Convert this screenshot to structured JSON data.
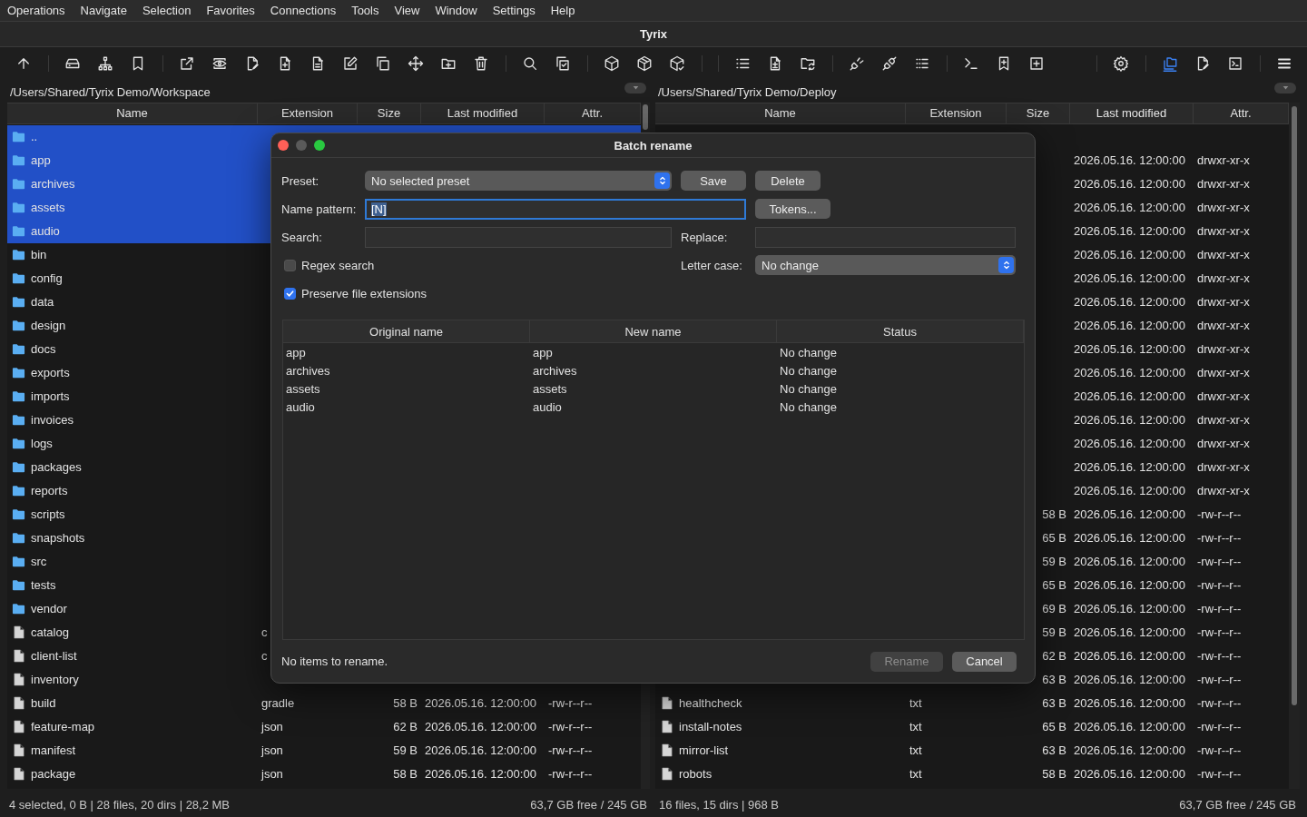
{
  "menu": [
    "Operations",
    "Navigate",
    "Selection",
    "Favorites",
    "Connections",
    "Tools",
    "View",
    "Window",
    "Settings",
    "Help"
  ],
  "window": {
    "title": "Tyrix"
  },
  "toolbar": [
    {
      "selected": false
    },
    {
      "selected": false
    },
    {
      "selected": false
    },
    {
      "selected": false
    },
    {
      "selected": false
    },
    {
      "selected": false
    },
    {
      "selected": false
    },
    {
      "selected": false
    },
    {
      "selected": false
    },
    {
      "selected": false
    },
    {
      "selected": false
    },
    {
      "selected": false
    },
    {
      "selected": false
    },
    {
      "selected": false
    },
    {
      "selected": false
    },
    {
      "selected": false
    },
    {
      "selected": false
    },
    {
      "selected": false
    },
    {
      "selected": false
    },
    {
      "selected": false
    },
    {
      "selected": false
    },
    {
      "selected": false
    },
    {
      "selected": false
    },
    {
      "selected": false
    },
    {
      "selected": false
    },
    {
      "selected": false
    },
    {
      "selected": false
    },
    {
      "selected": false
    },
    {
      "selected": false
    },
    {
      "selected": true
    },
    {
      "selected": false
    },
    {
      "selected": false
    },
    {
      "selected": false
    }
  ],
  "left_panel": {
    "path": "/Users/Shared/Tyrix Demo/Workspace",
    "columns": [
      "Name",
      "Extension",
      "Size",
      "Last modified",
      "Attr."
    ],
    "rows": [
      {
        "kind": "up",
        "name": "..",
        "selected": true
      },
      {
        "kind": "dir",
        "name": "app",
        "selected": true
      },
      {
        "kind": "dir",
        "name": "archives",
        "selected": true
      },
      {
        "kind": "dir",
        "name": "assets",
        "selected": true
      },
      {
        "kind": "dir",
        "name": "audio",
        "selected": true
      },
      {
        "kind": "dir",
        "name": "bin",
        "selected": false
      },
      {
        "kind": "dir",
        "name": "config",
        "selected": false
      },
      {
        "kind": "dir",
        "name": "data",
        "selected": false
      },
      {
        "kind": "dir",
        "name": "design",
        "selected": false
      },
      {
        "kind": "dir",
        "name": "docs",
        "selected": false
      },
      {
        "kind": "dir",
        "name": "exports",
        "selected": false
      },
      {
        "kind": "dir",
        "name": "imports",
        "selected": false
      },
      {
        "kind": "dir",
        "name": "invoices",
        "selected": false
      },
      {
        "kind": "dir",
        "name": "logs",
        "selected": false
      },
      {
        "kind": "dir",
        "name": "packages",
        "selected": false
      },
      {
        "kind": "dir",
        "name": "reports",
        "selected": false
      },
      {
        "kind": "dir",
        "name": "scripts",
        "selected": false
      },
      {
        "kind": "dir",
        "name": "snapshots",
        "selected": false
      },
      {
        "kind": "dir",
        "name": "src",
        "selected": false
      },
      {
        "kind": "dir",
        "name": "tests",
        "selected": false
      },
      {
        "kind": "dir",
        "name": "vendor",
        "selected": false
      },
      {
        "kind": "file",
        "name": "catalog",
        "ext": "c",
        "selected": false
      },
      {
        "kind": "file",
        "name": "client-list",
        "ext": "c",
        "selected": false
      },
      {
        "kind": "file",
        "name": "inventory",
        "selected": false
      },
      {
        "kind": "file",
        "name": "build",
        "ext": "gradle",
        "size": "58 B",
        "date": "2026.05.16. 12:00:00",
        "attr": "-rw-r--r--",
        "selected": false
      },
      {
        "kind": "file",
        "name": "feature-map",
        "ext": "json",
        "size": "62 B",
        "date": "2026.05.16. 12:00:00",
        "attr": "-rw-r--r--",
        "selected": false
      },
      {
        "kind": "file",
        "name": "manifest",
        "ext": "json",
        "size": "59 B",
        "date": "2026.05.16. 12:00:00",
        "attr": "-rw-r--r--",
        "selected": false
      },
      {
        "kind": "file",
        "name": "package",
        "ext": "json",
        "size": "58 B",
        "date": "2026.05.16. 12:00:00",
        "attr": "-rw-r--r--",
        "selected": false
      }
    ],
    "status": "4 selected, 0 B | 28 files, 20 dirs | 28,2 MB",
    "free": "63,7 GB free / 245 GB"
  },
  "right_panel": {
    "path": "/Users/Shared/Tyrix Demo/Deploy",
    "columns": [
      "Name",
      "Extension",
      "Size",
      "Last modified",
      "Attr."
    ],
    "rows": [
      {
        "date": "2026.05.16. 12:00:00",
        "attr": "drwxr-xr-x",
        "selected": false
      },
      {
        "date": "2026.05.16. 12:00:00",
        "attr": "drwxr-xr-x",
        "selected": false
      },
      {
        "date": "2026.05.16. 12:00:00",
        "attr": "drwxr-xr-x",
        "selected": false
      },
      {
        "date": "2026.05.16. 12:00:00",
        "attr": "drwxr-xr-x",
        "selected": false
      },
      {
        "date": "2026.05.16. 12:00:00",
        "attr": "drwxr-xr-x",
        "selected": false
      },
      {
        "date": "2026.05.16. 12:00:00",
        "attr": "drwxr-xr-x",
        "selected": false
      },
      {
        "date": "2026.05.16. 12:00:00",
        "attr": "drwxr-xr-x",
        "selected": false
      },
      {
        "date": "2026.05.16. 12:00:00",
        "attr": "drwxr-xr-x",
        "selected": false
      },
      {
        "date": "2026.05.16. 12:00:00",
        "attr": "drwxr-xr-x",
        "selected": false
      },
      {
        "date": "2026.05.16. 12:00:00",
        "attr": "drwxr-xr-x",
        "selected": false
      },
      {
        "date": "2026.05.16. 12:00:00",
        "attr": "drwxr-xr-x",
        "selected": false
      },
      {
        "date": "2026.05.16. 12:00:00",
        "attr": "drwxr-xr-x",
        "selected": false
      },
      {
        "date": "2026.05.16. 12:00:00",
        "attr": "drwxr-xr-x",
        "selected": false
      },
      {
        "date": "2026.05.16. 12:00:00",
        "attr": "drwxr-xr-x",
        "selected": false
      },
      {
        "date": "2026.05.16. 12:00:00",
        "attr": "drwxr-xr-x",
        "selected": false
      },
      {
        "size": "58 B",
        "date": "2026.05.16. 12:00:00",
        "attr": "-rw-r--r--",
        "selected": false
      },
      {
        "size": "65 B",
        "date": "2026.05.16. 12:00:00",
        "attr": "-rw-r--r--",
        "selected": false
      },
      {
        "size": "59 B",
        "date": "2026.05.16. 12:00:00",
        "attr": "-rw-r--r--",
        "selected": false
      },
      {
        "size": "65 B",
        "date": "2026.05.16. 12:00:00",
        "attr": "-rw-r--r--",
        "selected": false
      },
      {
        "size": "69 B",
        "date": "2026.05.16. 12:00:00",
        "attr": "-rw-r--r--",
        "selected": false
      },
      {
        "size": "59 B",
        "date": "2026.05.16. 12:00:00",
        "attr": "-rw-r--r--",
        "selected": false
      },
      {
        "size": "62 B",
        "date": "2026.05.16. 12:00:00",
        "attr": "-rw-r--r--",
        "selected": false
      },
      {
        "size": "63 B",
        "date": "2026.05.16. 12:00:00",
        "attr": "-rw-r--r--",
        "selected": false
      },
      {
        "kind": "file",
        "name": "healthcheck",
        "ext": "txt",
        "size": "63 B",
        "date": "2026.05.16. 12:00:00",
        "attr": "-rw-r--r--",
        "selected": false
      },
      {
        "kind": "file",
        "name": "install-notes",
        "ext": "txt",
        "size": "65 B",
        "date": "2026.05.16. 12:00:00",
        "attr": "-rw-r--r--",
        "selected": false
      },
      {
        "kind": "file",
        "name": "mirror-list",
        "ext": "txt",
        "size": "63 B",
        "date": "2026.05.16. 12:00:00",
        "attr": "-rw-r--r--",
        "selected": false
      },
      {
        "kind": "file",
        "name": "robots",
        "ext": "txt",
        "size": "58 B",
        "date": "2026.05.16. 12:00:00",
        "attr": "-rw-r--r--",
        "selected": false
      }
    ],
    "status": "16 files, 15 dirs | 968 B",
    "free": "63,7 GB free / 245 GB"
  },
  "dialog": {
    "title": "Batch rename",
    "preset": {
      "label": "Preset:",
      "value": "No selected preset"
    },
    "save_button": "Save",
    "delete_button": "Delete",
    "name_pattern": {
      "label": "Name pattern:",
      "value": "[N]",
      "focused": true,
      "text_selected": true
    },
    "tokens_button": "Tokens...",
    "search": {
      "label": "Search:"
    },
    "replace": {
      "label": "Replace:"
    },
    "regex": {
      "label": "Regex search",
      "checked": false
    },
    "letter_case": {
      "label": "Letter case:",
      "value": "No change"
    },
    "preserve_extensions": {
      "label": "Preserve file extensions",
      "checked": true
    },
    "table": {
      "columns": [
        "Original name",
        "New name",
        "Status"
      ],
      "rows": [
        [
          "app",
          "app",
          "No change"
        ],
        [
          "archives",
          "archives",
          "No change"
        ],
        [
          "assets",
          "assets",
          "No change"
        ],
        [
          "audio",
          "audio",
          "No change"
        ]
      ]
    },
    "status": "No items to rename.",
    "buttons": [
      {
        "label": "Rename",
        "disabled": true
      },
      {
        "label": "Cancel",
        "disabled": false
      }
    ]
  }
}
